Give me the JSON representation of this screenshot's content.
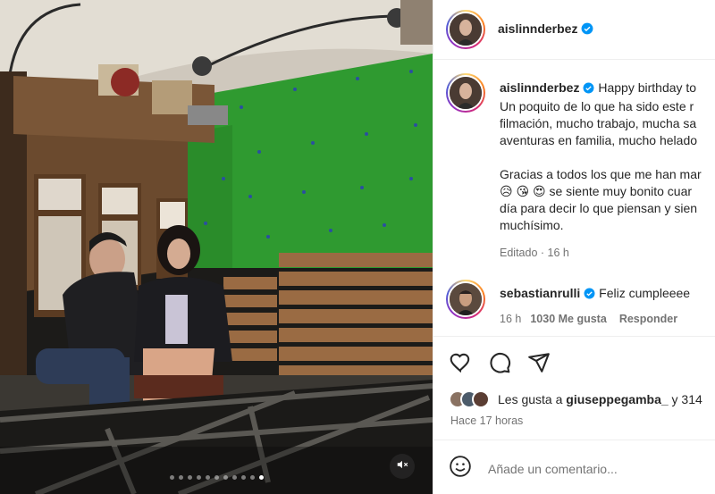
{
  "post": {
    "username": "aislinnderbez",
    "caption_lines": [
      "Happy birthday to",
      "Un poquito de lo que ha sido este r",
      "filmación, mucho trabajo, mucha sa",
      "aventuras en familia, mucho helado",
      "",
      "Gracias a todos los que me han mar",
      "se siente muy bonito cuar",
      "día para decir lo que piensan y sien",
      "muchísimo."
    ],
    "caption_emojis": [
      "😥",
      "😘",
      "😍"
    ],
    "caption_meta": "Editado · 16 h"
  },
  "comment": {
    "username": "sebastianrulli",
    "text": "Feliz cumpleeee",
    "time": "16 h",
    "likes": "1030 Me gusta",
    "reply": "Responder"
  },
  "likes": {
    "prefix": "Les gusta a ",
    "user": "giuseppegamba_",
    "suffix": " y 314"
  },
  "time_ago": "Hace 17 horas",
  "add_comment": {
    "placeholder": "Añade un comentario..."
  },
  "carousel": {
    "count": 11,
    "active_index": 10
  },
  "colors": {
    "verified": "#0095f6",
    "muted_text": "#737373",
    "green_screen": "#2f9a30"
  },
  "icons": [
    "verified-icon",
    "heart-icon",
    "comment-icon",
    "share-icon",
    "emoji-icon",
    "mute-icon"
  ]
}
